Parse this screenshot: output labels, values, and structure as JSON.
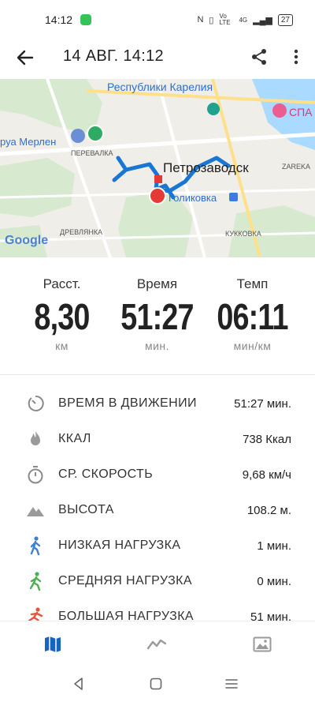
{
  "status_bar": {
    "time": "14:12",
    "signal_text": "Vo LTE",
    "network": "4G",
    "battery": "27"
  },
  "header": {
    "title": "14 АВГ. 14:12"
  },
  "map": {
    "labels": {
      "karelia": "Республики Карелия",
      "merlen": "руа Мерлен",
      "perevalka": "ПЕРЕВАЛКА",
      "petrozavodsk": "Петрозаводск",
      "zareka": "ZAREKA",
      "golikovka": "Голиковка",
      "drevlyanka": "ДРЕВЛЯНКА",
      "kukkovka": "КУККОВКА",
      "spa": "СПА",
      "google": "Google"
    }
  },
  "stats": [
    {
      "label": "Расст.",
      "value": "8,30",
      "unit": "км"
    },
    {
      "label": "Время",
      "value": "51:27",
      "unit": "мин."
    },
    {
      "label": "Темп",
      "value": "06:11",
      "unit": "мин/км"
    }
  ],
  "rows": [
    {
      "icon": "moving-time-icon",
      "name": "ВРЕМЯ В ДВИЖЕНИИ",
      "value": "51:27 мин."
    },
    {
      "icon": "flame-icon",
      "name": "ККАЛ",
      "value": "738 Ккал"
    },
    {
      "icon": "stopwatch-icon",
      "name": "СР. СКОРОСТЬ",
      "value": "9,68 км/ч"
    },
    {
      "icon": "mountain-icon",
      "name": "ВЫСОТА",
      "value": "108.2 м."
    },
    {
      "icon": "walker-blue-icon",
      "name": "НИЗКАЯ НАГРУЗКА",
      "value": "1 мин."
    },
    {
      "icon": "walker-green-icon",
      "name": "СРЕДНЯЯ НАГРУЗКА",
      "value": "0 мин."
    },
    {
      "icon": "runner-red-icon",
      "name": "БОЛЬШАЯ НАГРУЗКА",
      "value": "51 мин."
    }
  ],
  "colors": {
    "accent": "#1565c0",
    "route": "#1976d2",
    "low": "#3f7fd6",
    "medium": "#4caf50",
    "high": "#e5533d",
    "map_pin_red": "#e53935",
    "map_pin_green": "#2eaa62"
  }
}
